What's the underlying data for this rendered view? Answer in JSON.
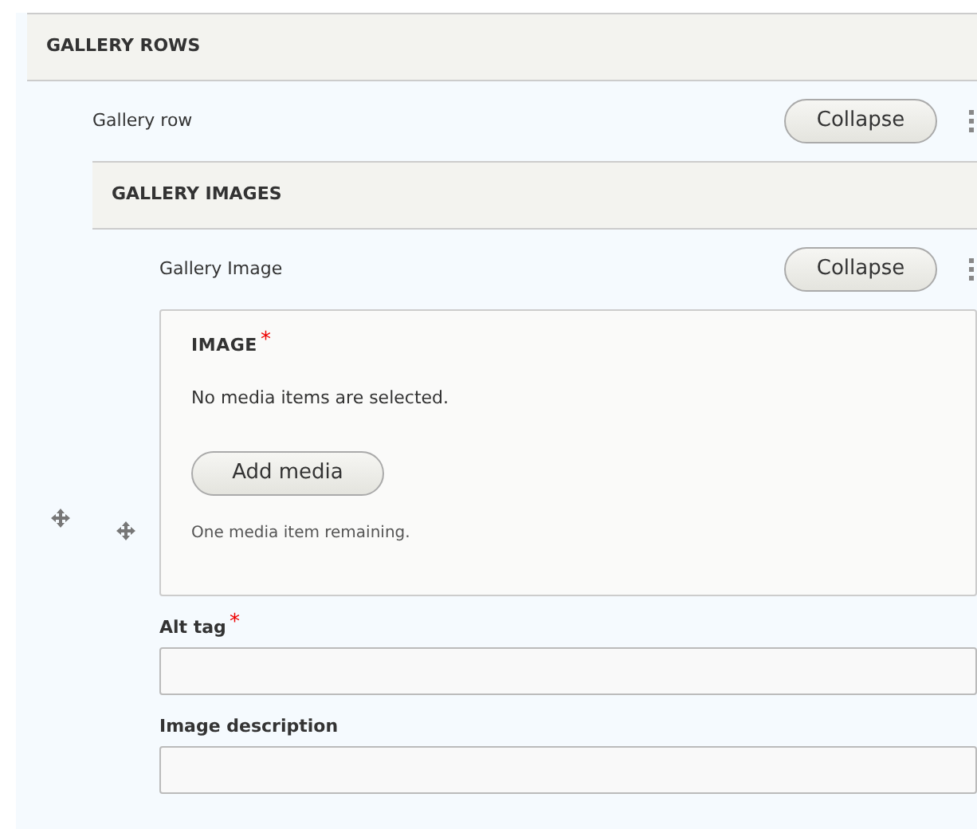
{
  "section": {
    "title": "GALLERY ROWS"
  },
  "row": {
    "label": "Gallery row",
    "button": "Collapse"
  },
  "subsection": {
    "title": "GALLERY IMAGES"
  },
  "item": {
    "label": "Gallery Image",
    "button": "Collapse"
  },
  "image_field": {
    "title": "IMAGE",
    "required_mark": "*",
    "message": "No media items are selected.",
    "button": "Add media",
    "hint": "One media item remaining."
  },
  "fields": [
    {
      "label": "Alt tag",
      "required_mark": "*"
    },
    {
      "label": "Image description"
    }
  ]
}
